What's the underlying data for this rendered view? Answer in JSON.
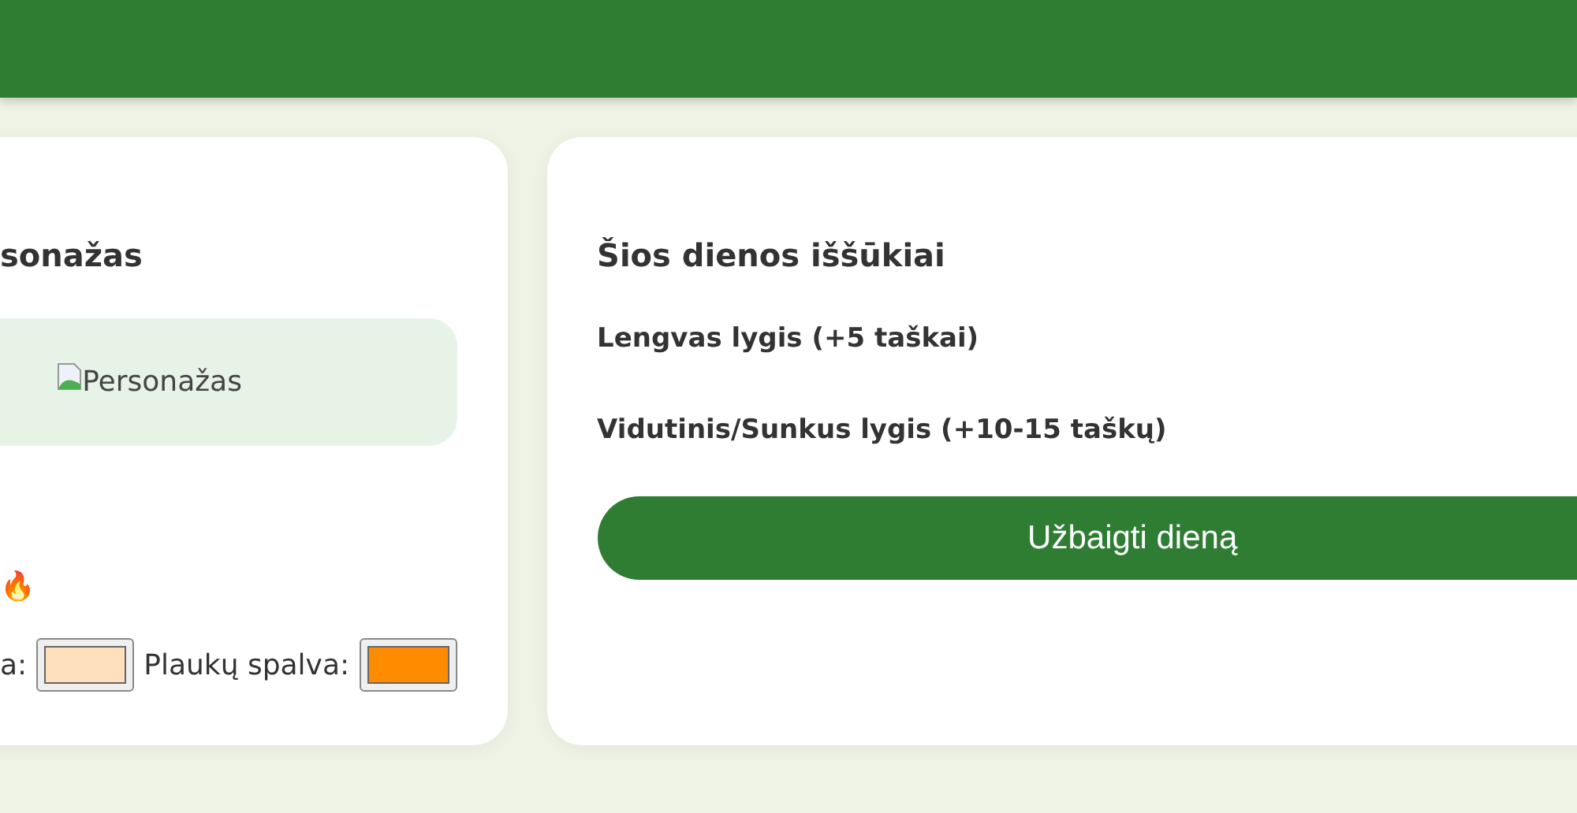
{
  "character_card": {
    "title": "sonažas",
    "image": {
      "alt": "Personažas"
    },
    "streak_icon": "🔥",
    "skin_label": "a:",
    "skin_color": {
      "color": "#ffe0bd"
    },
    "hair_label": "Plaukų spalva:",
    "hair_color": {
      "color": "#ff8c00"
    }
  },
  "challenges_card": {
    "title": "Šios dienos iššūkiai",
    "levels": [
      "Lengvas lygis (+5 taškai)",
      "Vidutinis/Sunkus lygis (+10-15 taškų)"
    ],
    "finish_button": "Užbaigti dieną"
  }
}
